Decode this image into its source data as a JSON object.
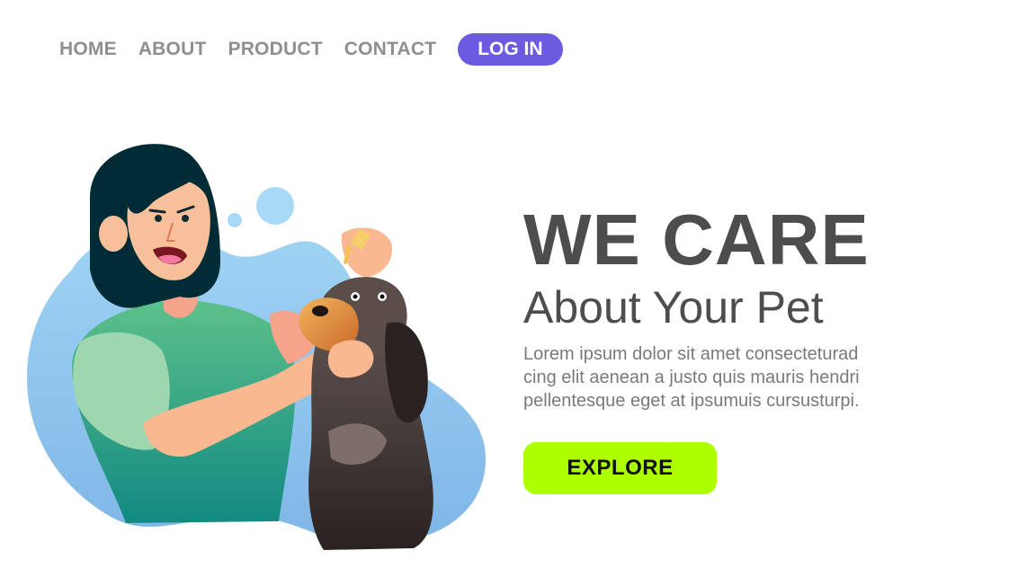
{
  "nav": {
    "items": [
      {
        "label": "HOME"
      },
      {
        "label": "ABOUT"
      },
      {
        "label": "PRODUCT"
      },
      {
        "label": "CONTACT"
      }
    ],
    "login_label": "LOG IN"
  },
  "hero": {
    "title": "WE CARE",
    "subtitle": "About Your Pet",
    "body_lines": [
      "Lorem ipsum dolor sit amet consecteturad",
      "cing elit aenean a justo quis mauris hendri",
      "pellentesque eget at ipsumuis cursusturpi."
    ],
    "cta_label": "EXPLORE"
  },
  "colors": {
    "nav_text": "#8f8f8f",
    "login_bg": "#6b5be0",
    "heading_text": "#4d4d4d",
    "body_text": "#7a7a7a",
    "cta_bg": "#adff00",
    "blob": "#8ec6ee"
  },
  "illustration": {
    "icon": "woman-giving-eye-drops-to-dog-illustration"
  }
}
